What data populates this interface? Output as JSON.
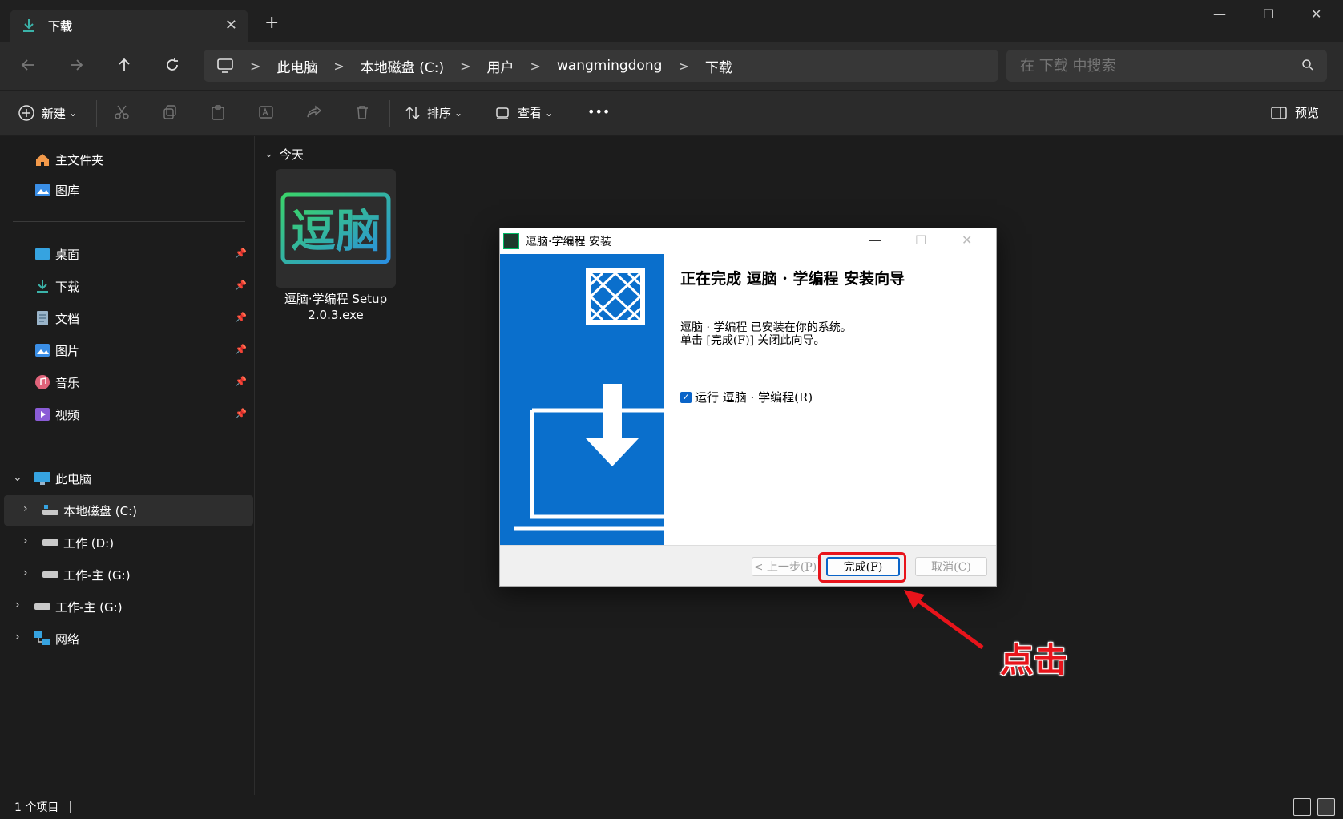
{
  "window": {
    "tab_label": "下载",
    "tab_close": "✕",
    "new_tab": "+",
    "minimize": "—",
    "maximize": "☐",
    "close": "✕"
  },
  "address": {
    "crumbs": [
      "此电脑",
      "本地磁盘 (C:)",
      "用户",
      "wangmingdong",
      "下载"
    ],
    "separator": ">",
    "search_placeholder": "在 下载 中搜索"
  },
  "toolbar": {
    "new_label": "新建",
    "sort_label": "排序",
    "view_label": "查看",
    "more_label": "•••",
    "preview_label": "预览",
    "dropdown_glyph": "⌄"
  },
  "sidebar": {
    "quick": [
      {
        "label": "主文件夹",
        "icon": "home-icon"
      },
      {
        "label": "图库",
        "icon": "gallery-icon"
      }
    ],
    "pinned": [
      {
        "label": "桌面",
        "icon": "desktop-icon"
      },
      {
        "label": "下载",
        "icon": "download-icon"
      },
      {
        "label": "文档",
        "icon": "document-icon"
      },
      {
        "label": "图片",
        "icon": "pictures-icon"
      },
      {
        "label": "音乐",
        "icon": "music-icon"
      },
      {
        "label": "视频",
        "icon": "video-icon"
      }
    ],
    "this_pc": "此电脑",
    "drives": [
      "本地磁盘 (C:)",
      "工作 (D:)",
      "工作-主 (G:)"
    ],
    "other": [
      "工作-主 (G:)",
      "网络"
    ]
  },
  "content": {
    "group": "今天",
    "file_name_line1": "逗脑·学编程 Setup",
    "file_name_line2": "2.0.3.exe",
    "logo_text": "逗脑"
  },
  "dialog": {
    "title": "逗脑·学编程 安装",
    "heading": "正在完成 逗脑 · 学编程 安装向导",
    "body_line1": "逗脑 · 学编程 已安装在你的系统。",
    "body_line2": "单击 [完成(F)] 关闭此向导。",
    "checkbox_label": "运行 逗脑 · 学编程(R)",
    "checkbox_checked": true,
    "back_button": "< 上一步(P)",
    "finish_button": "完成(F)",
    "cancel_button": "取消(C)"
  },
  "annotation": {
    "text": "点击",
    "color": "#e8141b"
  },
  "status": {
    "item_count": "1 个项目",
    "bar": "|"
  },
  "colors": {
    "installer_blue": "#0a6fcc",
    "explorer_bg": "#1c1c1c",
    "accent": "#0a64c8"
  }
}
